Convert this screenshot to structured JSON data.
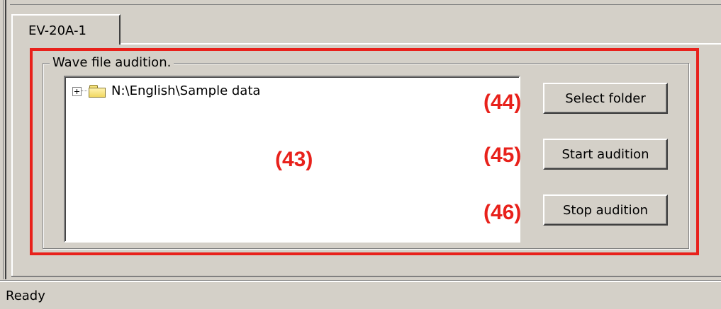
{
  "tab": {
    "label": "EV-20A-1"
  },
  "group": {
    "legend": "Wave file audition."
  },
  "tree": {
    "root_label": "N:\\English\\Sample data"
  },
  "buttons": {
    "select_folder": "Select folder",
    "start_audition": "Start audition",
    "stop_audition": "Stop audition"
  },
  "callouts": {
    "tree": "(43)",
    "select_folder": "(44)",
    "start_audition": "(45)",
    "stop_audition": "(46)"
  },
  "status": {
    "text": "Ready"
  },
  "colors": {
    "callout_red": "#e8211b",
    "face": "#d4d0c8",
    "shadow": "#808080",
    "highlight": "#ffffff"
  },
  "icons": {
    "expand": "plus-box-icon",
    "folder": "folder-icon"
  }
}
